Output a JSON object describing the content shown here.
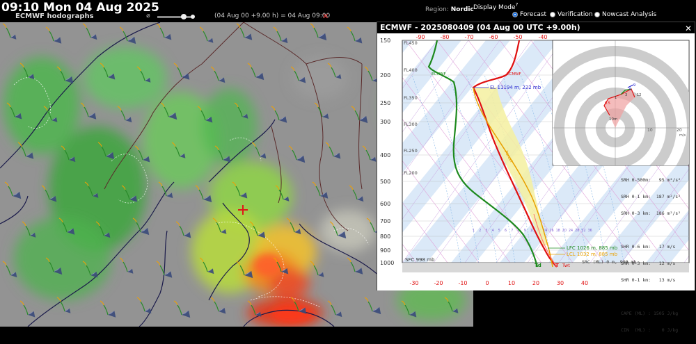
{
  "header": {
    "clock": "09:10 Mon 04 Aug 2025",
    "layer_title": "ECMWF hodographs",
    "slider_symbol": "⌀",
    "time_readout": "(04 Aug 00 +9.00 h) = 04 Aug 09:00",
    "close_glyph": "✕"
  },
  "region": {
    "label": "Region:",
    "value": "Nordic"
  },
  "display_mode": {
    "label": "Display Mode",
    "help": "?",
    "options": [
      "Forecast",
      "Verification",
      "Nowcast Analysis"
    ],
    "selected": "Forecast"
  },
  "panel": {
    "title": "ECMWF - 2025080409 (04 Aug 00 UTC +9.00h)",
    "close_glyph": "✕",
    "top_temps": [
      "-90",
      "-80",
      "-70",
      "-60",
      "-50",
      "-40"
    ],
    "bottom_temps": [
      "-30",
      "-20",
      "-10",
      "0",
      "10",
      "20",
      "30",
      "40"
    ],
    "pressures": [
      "150",
      "200",
      "250",
      "300",
      "400",
      "500",
      "600",
      "700",
      "800",
      "900",
      "1000"
    ],
    "flight_levels": [
      "FL450",
      "FL400",
      "FL350",
      "FL300",
      "FL250",
      "FL200"
    ],
    "mixing_ratios": [
      "1",
      "2",
      "3",
      "4",
      "5",
      "6",
      "7",
      "8",
      "9",
      "10",
      "12",
      "14",
      "16",
      "18",
      "20",
      "24",
      "28",
      "32",
      "36"
    ],
    "el_label": "EL 11194 m, 222 mb",
    "lfc_label": "LFC 1026 m, 885 mb",
    "lcl_label": "LCL 1032 m, 885 mb",
    "parcel_label": "Parcel",
    "ecmwf_label_dew": "ECMWF",
    "ecmwf_label_temp": "ECMWF",
    "sfc_label": "SFC 998 mb",
    "src_label": "SRC (ML) 0 m, 998 mb",
    "td_label": "Td",
    "t_label": "T",
    "twet_label": "Twt",
    "hodo": {
      "axis_labels": [
        "10",
        "20",
        "m/s"
      ],
      "ring_label": "10m",
      "points": [
        "0.5",
        "1",
        "3",
        "6",
        "9",
        "12"
      ]
    },
    "stats": [
      "SRH 0-500m:   95 m²/s²",
      "SRH 0-1 km:  187 m²/s²",
      "SRH 0-3 km:  186 m²/s²",
      "",
      "SHR 0-6 km:   17 m/s",
      "SHR 0-3 km:   12 m/s",
      "SHR 0-1 km:   13 m/s",
      "",
      "CAPE (ML) : 1505 J/kg",
      "CIN  (ML) :    0 J/kg"
    ]
  },
  "colors": {
    "temp": "#e01010",
    "dew": "#1e8a1e",
    "parcel": "#e8a000",
    "cape_fill": "#f4f0a0",
    "accent_close": "#e33333"
  }
}
